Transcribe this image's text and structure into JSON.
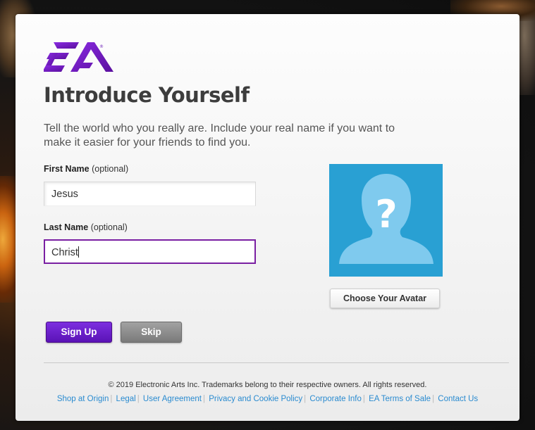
{
  "brand": {
    "logo_text": "EA",
    "accent": "#6b1fb8",
    "avatar_bg": "#29a0d3"
  },
  "page": {
    "title": "Introduce Yourself",
    "description": "Tell the world who you really are. Include your real name if you want to make it easier for your friends to find you."
  },
  "form": {
    "first_name": {
      "label": "First Name",
      "optional": "(optional)",
      "value": "Jesus"
    },
    "last_name": {
      "label": "Last Name",
      "optional": "(optional)",
      "value": "Christ"
    }
  },
  "avatar": {
    "icon": "unknown-person-icon",
    "button_label": "Choose Your Avatar"
  },
  "actions": {
    "signup_label": "Sign Up",
    "skip_label": "Skip"
  },
  "footer": {
    "copyright": "© 2019 Electronic Arts Inc. Trademarks belong to their respective owners. All rights reserved.",
    "links": [
      "Shop at Origin",
      "Legal",
      "User Agreement",
      "Privacy and Cookie Policy",
      "Corporate Info",
      "EA Terms of Sale",
      "Contact Us"
    ]
  }
}
